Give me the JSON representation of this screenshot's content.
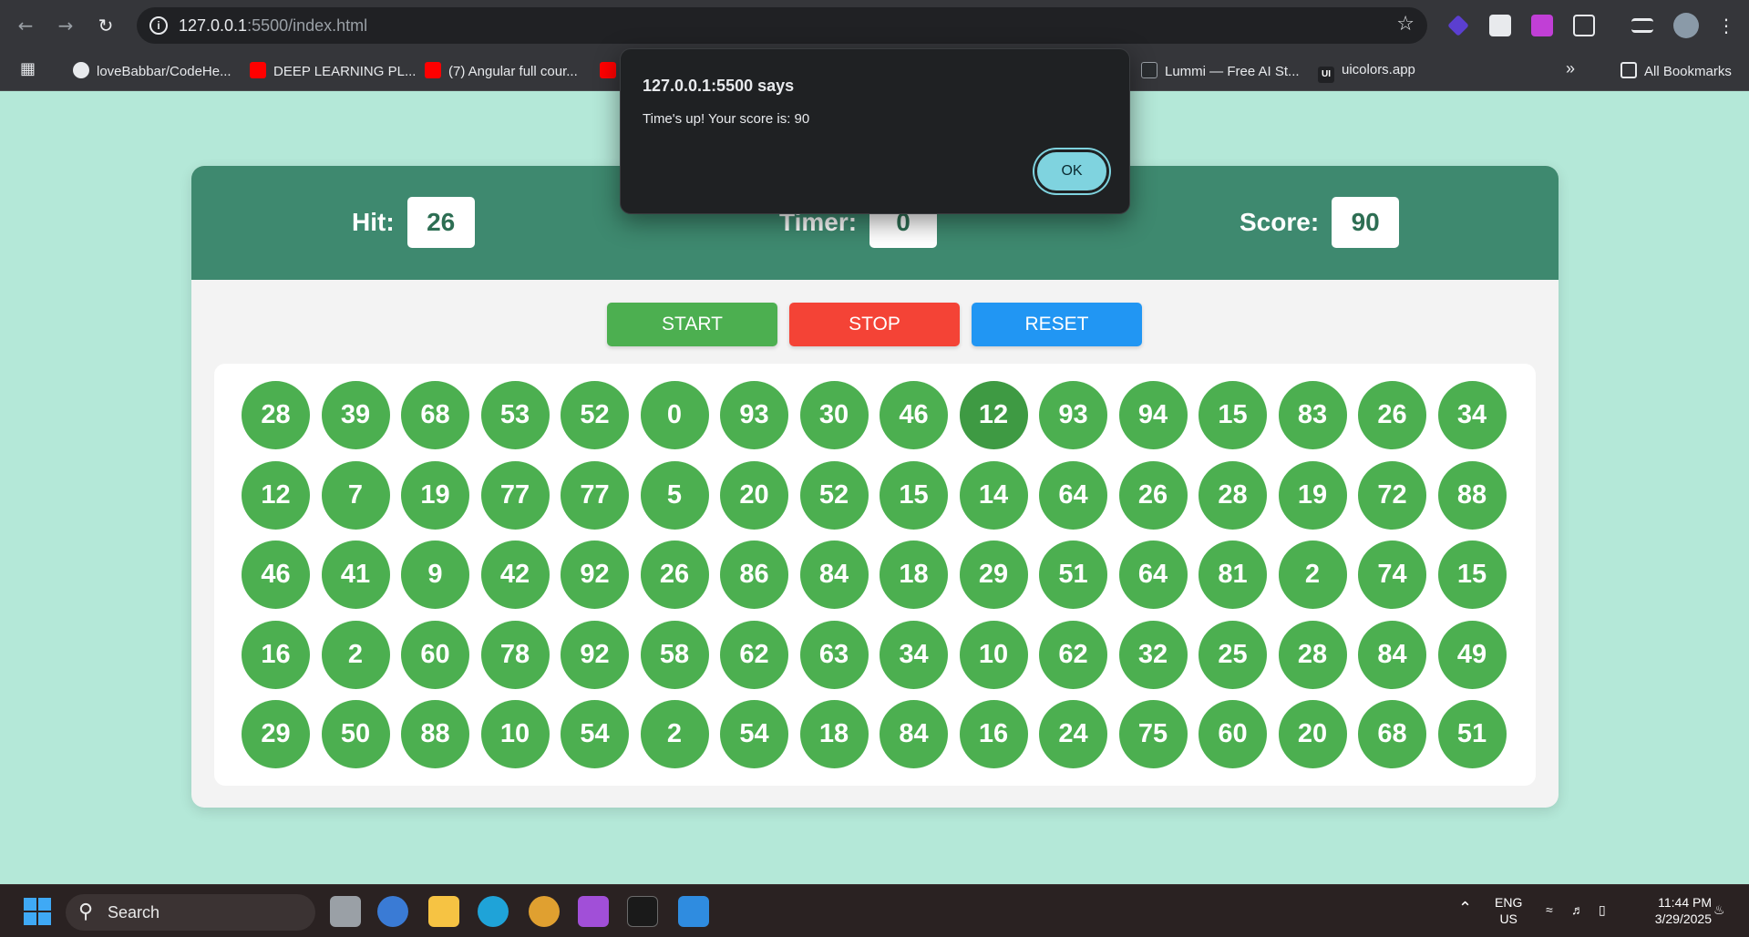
{
  "browser": {
    "url_host": "127.0.0.1",
    "url_rest": ":5500/index.html",
    "bookmarks": [
      "loveBabbar/CodeHe...",
      "DEEP LEARNING PL...",
      "(7) Angular full cour...",
      "Lummi — Free AI St...",
      "uicolors.app"
    ],
    "all_bookmarks": "All Bookmarks"
  },
  "game": {
    "hit_label": "Hit:",
    "hit_value": "26",
    "timer_label": "Timer:",
    "timer_value": "0",
    "score_label": "Score:",
    "score_value": "90",
    "start_label": "START",
    "stop_label": "STOP",
    "reset_label": "RESET",
    "colors": {
      "header": "#3e896f",
      "bubble": "#4caf50",
      "start": "#4caf50",
      "stop": "#f44336",
      "reset": "#2196f3"
    },
    "bubbles": [
      [
        28,
        39,
        68,
        53,
        52,
        0,
        93,
        30,
        46,
        12,
        93,
        94,
        15,
        83,
        26,
        34
      ],
      [
        12,
        7,
        19,
        77,
        77,
        5,
        20,
        52,
        15,
        14,
        64,
        26,
        28,
        19,
        72,
        88
      ],
      [
        46,
        41,
        9,
        42,
        92,
        26,
        86,
        84,
        18,
        29,
        51,
        64,
        81,
        2,
        74,
        15
      ],
      [
        16,
        2,
        60,
        78,
        92,
        58,
        62,
        63,
        34,
        10,
        62,
        32,
        25,
        28,
        84,
        49
      ],
      [
        29,
        50,
        88,
        10,
        54,
        2,
        54,
        18,
        84,
        16,
        24,
        75,
        60,
        20,
        68,
        51
      ]
    ]
  },
  "alert": {
    "title": "127.0.0.1:5500 says",
    "message": "Time's up! Your score is: 90",
    "ok_label": "OK"
  },
  "taskbar": {
    "search_placeholder": "Search",
    "lang_top": "ENG",
    "lang_bottom": "US",
    "time": "11:44 PM",
    "date": "3/29/2025"
  }
}
